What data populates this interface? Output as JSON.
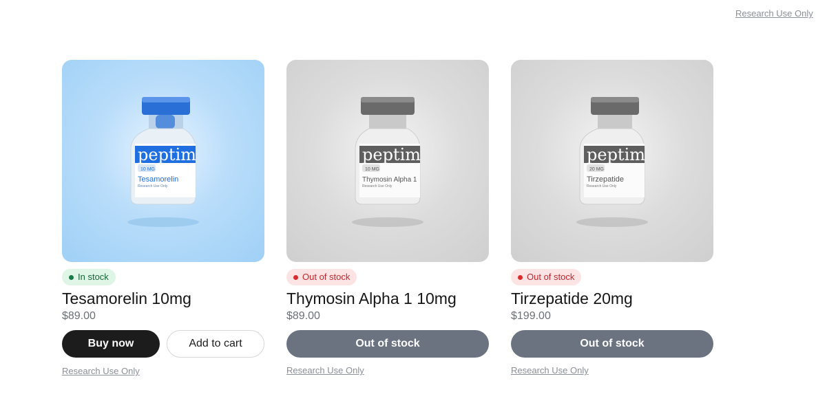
{
  "header": {
    "top_link": "Research Use Only"
  },
  "products": [
    {
      "brand": "peptim",
      "vial_dose": "10 MG",
      "vial_name": "Tesamorelin",
      "vial_note": "Research Use Only",
      "badge": "In stock",
      "title": "Tesamorelin 10mg",
      "price": "$89.00",
      "buy_label": "Buy now",
      "cart_label": "Add to cart",
      "note": "Research Use Only"
    },
    {
      "brand": "peptim",
      "vial_dose": "10 MG",
      "vial_name": "Thymosin Alpha 1",
      "vial_note": "Research Use Only",
      "badge": "Out of stock",
      "title": "Thymosin Alpha 1 10mg",
      "price": "$89.00",
      "button_label": "Out of stock",
      "note": "Research Use Only"
    },
    {
      "brand": "peptim",
      "vial_dose": "20 MG",
      "vial_name": "Tirzepatide",
      "vial_note": "Research Use Only",
      "badge": "Out of stock",
      "title": "Tirzepatide 20mg",
      "price": "$199.00",
      "button_label": "Out of stock",
      "note": "Research Use Only"
    }
  ],
  "colors": {
    "accent_blue": "#1f6fe0",
    "in_stock": "#1b7a43",
    "out_of_stock": "#d92d2d",
    "disabled_button": "#6b7280"
  }
}
